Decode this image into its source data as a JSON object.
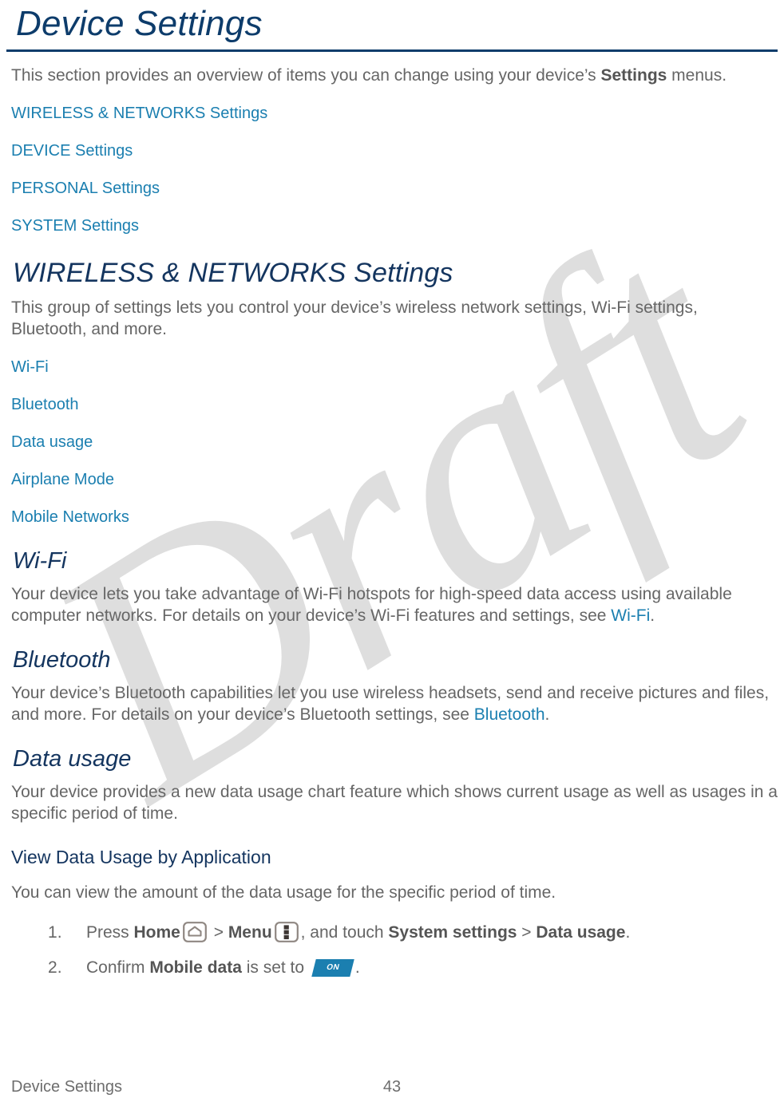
{
  "document": {
    "title": "Device Settings",
    "intro": {
      "before_bold": "This section provides an overview of items you can change using your device’s ",
      "bold": "Settings",
      "after_bold": " menus."
    },
    "toc_links": [
      "WIRELESS & NETWORKS Settings",
      "DEVICE Settings",
      "PERSONAL Settings",
      "SYSTEM Settings"
    ],
    "sections": [
      {
        "heading": "WIRELESS & NETWORKS Settings",
        "body": "This group of settings lets you control your device’s wireless network settings, Wi-Fi settings, Bluetooth, and more.",
        "links": [
          "Wi-Fi",
          "Bluetooth",
          "Data usage",
          "Airplane Mode",
          "Mobile Networks"
        ]
      },
      {
        "heading": "Wi-Fi",
        "body_before_link": "Your device lets you take advantage of Wi-Fi hotspots for high-speed data access using available computer networks. For details on your device’s Wi-Fi features and settings, see ",
        "body_link": "Wi-Fi",
        "body_after_link": "."
      },
      {
        "heading": "Bluetooth",
        "body_before_link": "Your device’s Bluetooth capabilities let you use wireless headsets, send and receive pictures and files, and more. For details on your device’s Bluetooth settings, see ",
        "body_link": "Bluetooth",
        "body_after_link": "."
      },
      {
        "heading": "Data usage",
        "body": "Your device provides a new data usage chart feature which shows current usage as well as usages in a specific period of time.",
        "subheading": "View Data Usage by Application",
        "sub_body": "You can view the amount of the data usage for the specific period of time.",
        "steps": [
          {
            "t1": "Press ",
            "b1": "Home",
            "icon1": "home-icon",
            "t2": " > ",
            "b2": "Menu",
            "icon2": "menu-icon",
            "t3": ", and touch ",
            "b3": "System settings",
            "t4": " > ",
            "b4": "Data usage",
            "t5": "."
          },
          {
            "t1": "Confirm ",
            "b1": "Mobile data",
            "t2": " is set to ",
            "toggle_label": "ON",
            "t3": "."
          }
        ]
      }
    ],
    "watermark": "Draft",
    "footer": {
      "left": "Device Settings",
      "page_number": "43"
    },
    "colors": {
      "heading_navy": "#14355f",
      "title_navy": "#0d3c6b",
      "link_blue": "#1b7fb0",
      "body_gray": "#666666",
      "watermark_gray": "#dedede"
    }
  }
}
